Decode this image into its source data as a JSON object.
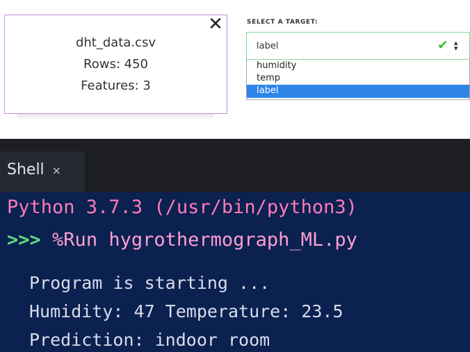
{
  "file_card": {
    "filename": "dht_data.csv",
    "rows": "Rows: 450",
    "features": "Features: 3",
    "close_glyph": "✕"
  },
  "target_select": {
    "label": "SELECT A TARGET:",
    "value": "label",
    "valid_icon": "check-icon",
    "options": [
      "humidity",
      "temp",
      "label"
    ],
    "selected_index": 2
  },
  "shell": {
    "tab_label": "Shell",
    "tab_close": "×",
    "version_line": "Python 3.7.3 (/usr/bin/python3)",
    "prompt": ">>>",
    "command": "%Run hygrothermograph_ML.py",
    "output": [
      "Program is starting ...",
      "Humidity: 47 Temperature: 23.5",
      "Prediction:  indoor room"
    ]
  },
  "colors": {
    "card_border": "#c58bdf",
    "select_border": "#7ed89a",
    "selected_option": "#2f86e8",
    "shell_bg": "#0b2150",
    "prompt_green": "#5fe07f",
    "python_pink": "#ff7bb7"
  }
}
